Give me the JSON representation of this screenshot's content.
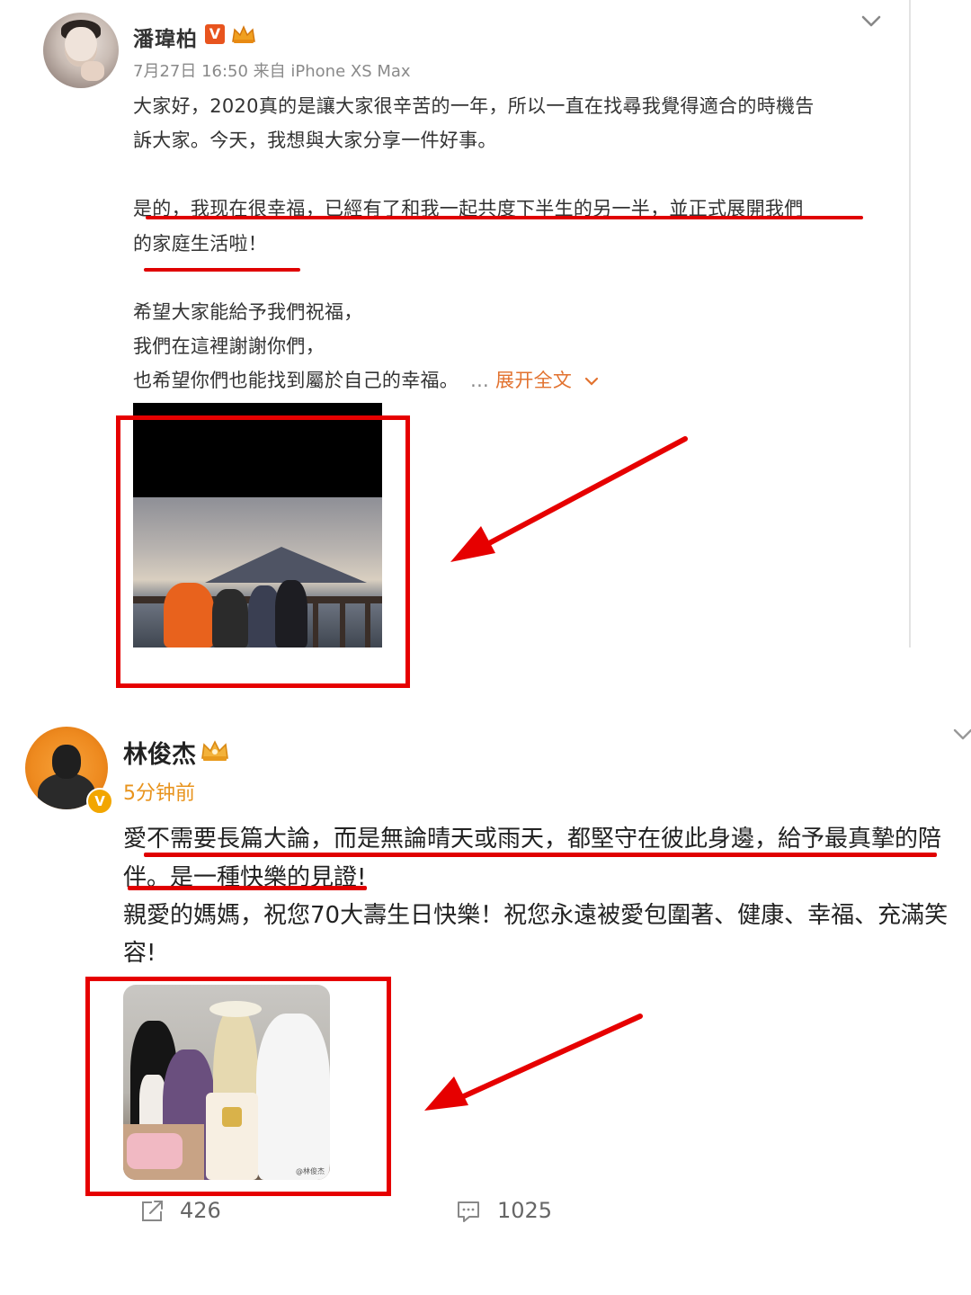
{
  "post1": {
    "author": "潘瑋柏",
    "verified_badge": "V",
    "meta": "7月27日 16:50 来自 iPhone XS Max",
    "lines": [
      "大家好，2020真的是讓大家很辛苦的一年，所以一直在找尋我覺得適合的時機告",
      "訴大家。今天，我想與大家分享一件好事。",
      "是的，我现在很幸福，已經有了和我一起共度下半生的另一半，並正式展開我們",
      "的家庭生活啦！",
      "希望大家能給予我們祝福，",
      "我們在這裡謝謝你們，",
      "也希望你們也能找到屬於自己的幸福。"
    ],
    "expand_prefix": "...",
    "expand_label": "展开全文",
    "photo": "post-image"
  },
  "post2": {
    "author": "林俊杰",
    "verified_badge": "V",
    "time": "5分钟前",
    "lines": [
      "愛不需要長篇大論，而是無論晴天或雨天，都堅守在彼此身邊，給予最真摯的陪",
      "伴。是一種快樂的見證!",
      "親愛的媽媽，祝您70大壽生日快樂！祝您永遠被愛包圍著、健康、幸福、充滿笑",
      "容!"
    ],
    "photo_watermark": "@林俊杰",
    "reposts": "426",
    "comments": "1025"
  },
  "colors": {
    "annotation_red": "#e60000",
    "expand_orange": "#e2722f",
    "time_orange": "#e8931c",
    "badge_orange": "#e8541e"
  },
  "icons": [
    "chevron-down-icon",
    "crown-icon",
    "repost-icon",
    "comment-icon",
    "arrow-annotation-icon"
  ]
}
